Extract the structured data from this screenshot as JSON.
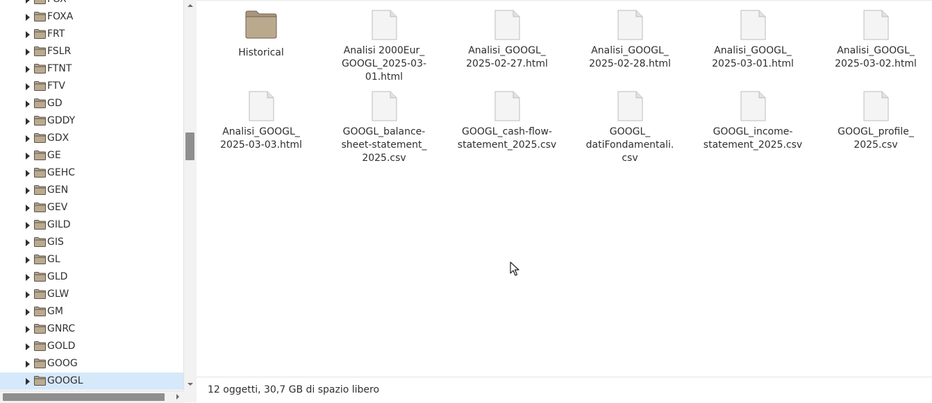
{
  "sidebar": {
    "items": [
      {
        "label": "FOX"
      },
      {
        "label": "FOXA"
      },
      {
        "label": "FRT"
      },
      {
        "label": "FSLR"
      },
      {
        "label": "FTNT"
      },
      {
        "label": "FTV"
      },
      {
        "label": "GD"
      },
      {
        "label": "GDDY"
      },
      {
        "label": "GDX"
      },
      {
        "label": "GE"
      },
      {
        "label": "GEHC"
      },
      {
        "label": "GEN"
      },
      {
        "label": "GEV"
      },
      {
        "label": "GILD"
      },
      {
        "label": "GIS"
      },
      {
        "label": "GL"
      },
      {
        "label": "GLD"
      },
      {
        "label": "GLW"
      },
      {
        "label": "GM"
      },
      {
        "label": "GNRC"
      },
      {
        "label": "GOLD"
      },
      {
        "label": "GOOG"
      },
      {
        "label": "GOOGL",
        "selected": true
      }
    ],
    "icon": "folder-icon"
  },
  "files": [
    {
      "line1": "Historical",
      "line2": "",
      "line3": "",
      "type": "folder"
    },
    {
      "line1": "Analisi 2000Eur_",
      "line2": "GOOGL_2025-03-",
      "line3": "01.html",
      "type": "file"
    },
    {
      "line1": "Analisi_GOOGL_",
      "line2": "2025-02-27.html",
      "line3": "",
      "type": "file"
    },
    {
      "line1": "Analisi_GOOGL_",
      "line2": "2025-02-28.html",
      "line3": "",
      "type": "file"
    },
    {
      "line1": "Analisi_GOOGL_",
      "line2": "2025-03-01.html",
      "line3": "",
      "type": "file"
    },
    {
      "line1": "Analisi_GOOGL_",
      "line2": "2025-03-02.html",
      "line3": "",
      "type": "file"
    },
    {
      "line1": "Analisi_GOOGL_",
      "line2": "2025-03-03.html",
      "line3": "",
      "type": "file"
    },
    {
      "line1": "GOOGL_balance-",
      "line2": "sheet-statement_",
      "line3": "2025.csv",
      "type": "file"
    },
    {
      "line1": "GOOGL_cash-flow-",
      "line2": "statement_2025.csv",
      "line3": "",
      "type": "file"
    },
    {
      "line1": "GOOGL_",
      "line2": "datiFondamentali.",
      "line3": "csv",
      "type": "file"
    },
    {
      "line1": "GOOGL_income-",
      "line2": "statement_2025.csv",
      "line3": "",
      "type": "file"
    },
    {
      "line1": "GOOGL_profile_",
      "line2": "2025.csv",
      "line3": "",
      "type": "file"
    }
  ],
  "status": {
    "text": "12 oggetti, 30,7 GB di spazio libero"
  },
  "colors": {
    "selection": "#d6e9fb",
    "folder": "#b5a48a",
    "scrollbar_thumb": "#8f8f8f"
  }
}
